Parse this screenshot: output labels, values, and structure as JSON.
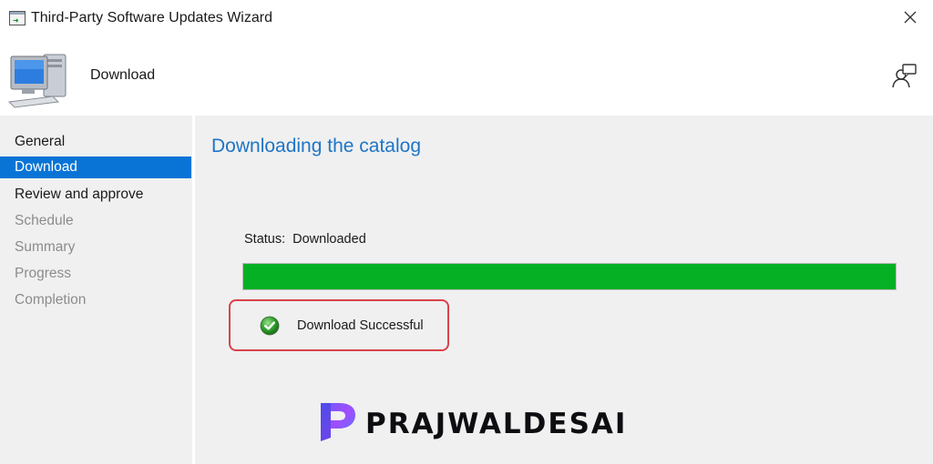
{
  "window": {
    "title": "Third-Party Software Updates Wizard",
    "close_icon": "close-icon",
    "app_icon": "wizard-window-icon"
  },
  "header": {
    "page_heading": "Download",
    "icon": "computer-icon",
    "help_icon": "help-person-icon"
  },
  "sidebar": {
    "items": [
      {
        "label": "General",
        "state": "normal"
      },
      {
        "label": "Download",
        "state": "active"
      },
      {
        "label": "Review and approve",
        "state": "normal"
      },
      {
        "label": "Schedule",
        "state": "disabled"
      },
      {
        "label": "Summary",
        "state": "disabled"
      },
      {
        "label": "Progress",
        "state": "disabled"
      },
      {
        "label": "Completion",
        "state": "disabled"
      }
    ]
  },
  "main": {
    "section_title": "Downloading the catalog",
    "status_label": "Status:",
    "status_value": "Downloaded",
    "progress_percent": 100,
    "result_icon": "check-circle-icon",
    "result_text": "Download Successful"
  },
  "watermark": {
    "brand": "PRAJWALDESAI",
    "logo": "prajwaldesai-logo"
  },
  "colors": {
    "accent": "#0a74d6",
    "title_blue": "#1e75c7",
    "progress_green": "#06b025",
    "callout_red": "#d9434b",
    "panel_gray": "#f0f0f0"
  }
}
